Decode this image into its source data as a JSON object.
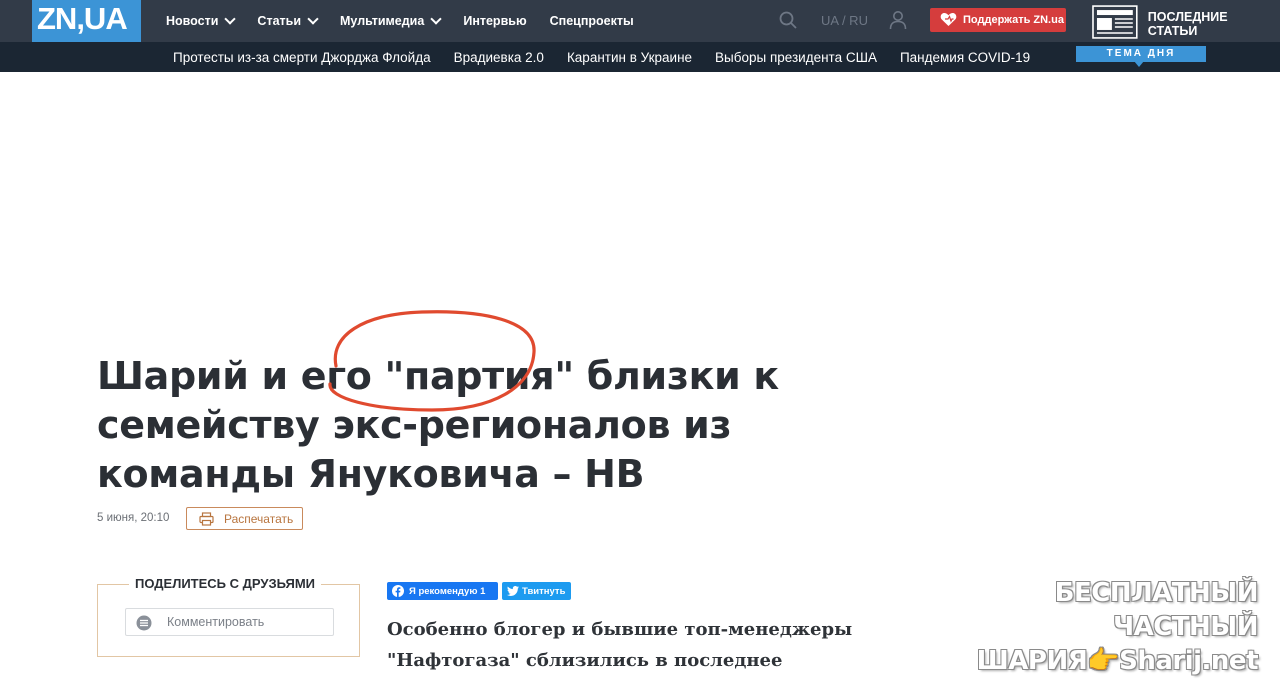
{
  "header": {
    "logo": "ZN,UA",
    "nav": [
      {
        "label": "Новости",
        "has_dropdown": true
      },
      {
        "label": "Статьи",
        "has_dropdown": true
      },
      {
        "label": "Мультимедиа",
        "has_dropdown": true
      },
      {
        "label": "Интервью",
        "has_dropdown": false
      },
      {
        "label": "Спецпроекты",
        "has_dropdown": false
      }
    ],
    "lang": "UA / RU",
    "support_label": "Поддержать ZN.ua",
    "latest_label": "ПОСЛЕДНИЕ СТАТЬИ"
  },
  "topics": [
    "Протесты из-за смерти Джорджа Флойда",
    "Врадиевка 2.0",
    "Карантин в Украине",
    "Выборы президента США",
    "Пандемия COVID-19"
  ],
  "tema_label": "ТЕМА ДНЯ",
  "article": {
    "title": "Шарий и его \"партия\" близки к семейству экс-регионалов из команды Януковича – НВ",
    "date": "5 июня, 20:10",
    "print_label": "Распечатать",
    "lead": "Особенно блогер и бывшие топ-менеджеры \"Нафтогаза\" сблизились в последнее время."
  },
  "share": {
    "title": "ПОДЕЛИТЕСЬ С ДРУЗЬЯМИ",
    "comment_placeholder": "Комментировать",
    "fb_label": "Я рекомендую 1",
    "tw_label": "Твитнуть"
  },
  "watermark": {
    "line1": "БЕСПЛАТНЫЙ ЧАСТНЫЙ",
    "line2": "ШАРИЯ👉Sharij.net"
  },
  "colors": {
    "topbar": "#323b48",
    "subbar": "#1b2633",
    "accent": "#3c94d6",
    "support": "#d53d3d",
    "annotation": "#e04a2f"
  }
}
